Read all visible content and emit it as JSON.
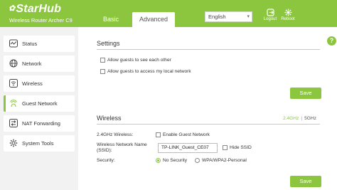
{
  "header": {
    "brand": "StarHub",
    "model": "Wireless Router Archer C9",
    "tabs": [
      {
        "label": "Basic"
      },
      {
        "label": "Advanced"
      }
    ],
    "language": "English",
    "logout_label": "Logout",
    "reboot_label": "Reboot"
  },
  "sidebar": {
    "items": [
      {
        "label": "Status",
        "icon": "status-icon"
      },
      {
        "label": "Network",
        "icon": "globe-icon"
      },
      {
        "label": "Wireless",
        "icon": "wifi-icon"
      },
      {
        "label": "Guest Network",
        "icon": "guest-icon",
        "active": true
      },
      {
        "label": "NAT Forwarding",
        "icon": "nat-icon"
      },
      {
        "label": "System Tools",
        "icon": "gear-icon"
      }
    ]
  },
  "settings": {
    "title": "Settings",
    "option1": "Allow guests to see each other",
    "option2": "Allow guests to access my local network",
    "save_label": "Save"
  },
  "wireless": {
    "title": "Wireless",
    "band_24": "2.4GHz",
    "band_5": "5GHz",
    "row1_label": "2.4GHz Wireless:",
    "enable_label": "Enable Guest Network",
    "ssid_label_line1": "Wireless Network Name",
    "ssid_label_line2": "(SSID):",
    "ssid_value": "TP-LINK_Guest_CE07",
    "hide_ssid_label": "Hide SSID",
    "security_label": "Security:",
    "no_security_label": "No Security",
    "wpa_label": "WPA/WPA2-Personal",
    "save_label": "Save"
  },
  "colors": {
    "accent": "#8cc63f"
  }
}
